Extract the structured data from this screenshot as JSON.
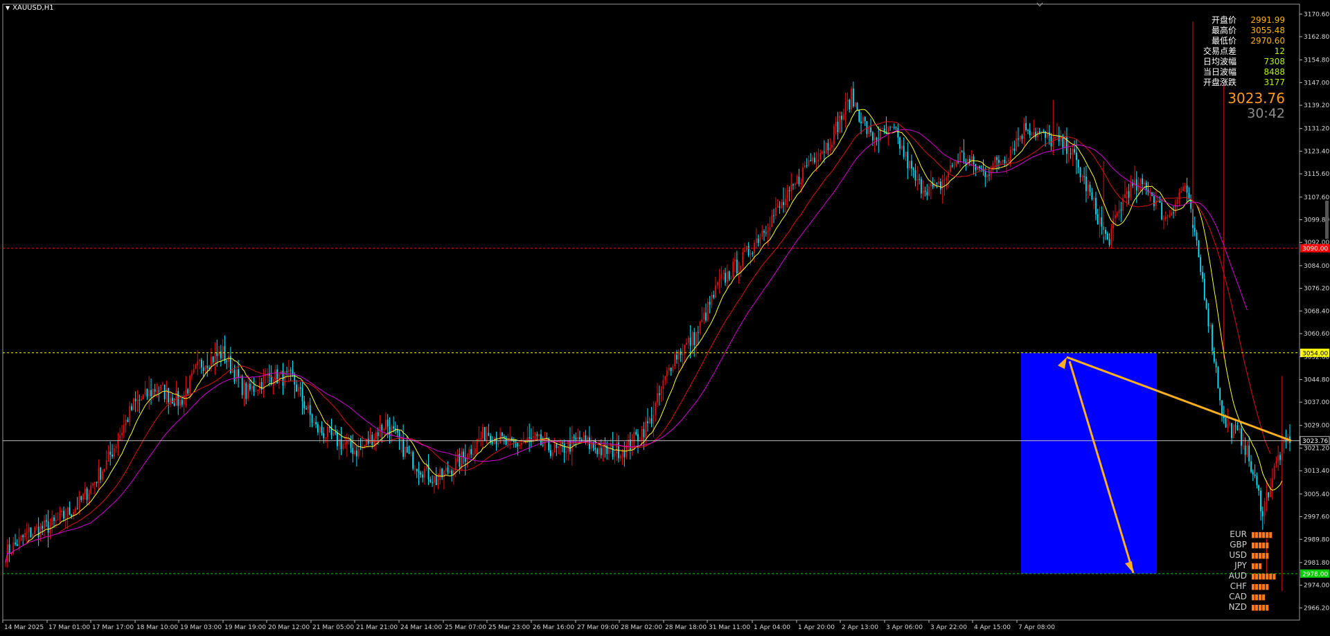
{
  "window": {
    "title": "XAUUSD,H1"
  },
  "info_panel": [
    {
      "label": "开盘价",
      "value": "2991.99"
    },
    {
      "label": "最高价",
      "value": "3055.48"
    },
    {
      "label": "最低价",
      "value": "2970.60"
    },
    {
      "label": "交易点差",
      "value": "12"
    },
    {
      "label": "日均波幅",
      "value": "7308"
    },
    {
      "label": "当日波幅",
      "value": "8488"
    },
    {
      "label": "开盘涨跌",
      "value": "3177"
    }
  ],
  "current_price": "3023.76",
  "timer": "30:42",
  "currency_strength": [
    {
      "name": "EUR",
      "bars": 6
    },
    {
      "name": "GBP",
      "bars": 5
    },
    {
      "name": "USD",
      "bars": 5
    },
    {
      "name": "JPY",
      "bars": 3
    },
    {
      "name": "AUD",
      "bars": 7
    },
    {
      "name": "CHF",
      "bars": 5
    },
    {
      "name": "CAD",
      "bars": 4
    },
    {
      "name": "NZD",
      "bars": 5
    }
  ],
  "colors": {
    "background": "#000000",
    "bull_candle": "#e01010",
    "bear_candle": "#00e5ff",
    "ma_fast": "#ffff33",
    "ma_mid": "#dd1111",
    "ma_slow": "#d400d4",
    "zone": "#0000ff",
    "arrow": "#ffb020",
    "label_red": "#ff0000",
    "label_yellow": "#ffff00",
    "label_green": "#00cc00"
  },
  "chart_data": {
    "type": "candlestick",
    "symbol": "XAUUSD,H1",
    "ylim": [
      2962.0,
      3174.0
    ],
    "y_ticks": [
      "3170.60",
      "3162.80",
      "3154.80",
      "3147.00",
      "3139.20",
      "3131.20",
      "3123.40",
      "3115.60",
      "3107.60",
      "3099.80",
      "3092.00",
      "3084.00",
      "3076.20",
      "3068.40",
      "3060.60",
      "3052.60",
      "3044.80",
      "3037.00",
      "3029.00",
      "3021.20",
      "3013.40",
      "3005.40",
      "2997.60",
      "2989.80",
      "2981.80",
      "2974.00",
      "2966.20"
    ],
    "x_labels": [
      "14 Mar 2025",
      "17 Mar 01:00",
      "17 Mar 17:00",
      "18 Mar 10:00",
      "19 Mar 03:00",
      "19 Mar 19:00",
      "20 Mar 12:00",
      "21 Mar 05:00",
      "21 Mar 21:00",
      "24 Mar 14:00",
      "25 Mar 07:00",
      "25 Mar 23:00",
      "26 Mar 16:00",
      "27 Mar 09:00",
      "28 Mar 02:00",
      "28 Mar 18:00",
      "31 Mar 11:00",
      "1 Apr 04:00",
      "1 Apr 20:00",
      "2 Apr 13:00",
      "3 Apr 06:00",
      "3 Apr 22:00",
      "4 Apr 15:00",
      "7 Apr 08:00"
    ],
    "horizontal_lines": [
      {
        "price": 3090.0,
        "label": "3090.00",
        "color": "#ff0000",
        "style": "dashed"
      },
      {
        "price": 3054.0,
        "label": "3054.00",
        "color": "#ffff00",
        "style": "dashed"
      },
      {
        "price": 3023.76,
        "label": "3023.76",
        "color": "#c0c0c0",
        "style": "solid"
      },
      {
        "price": 2978.0,
        "label": "2978.00",
        "color": "#00cc00",
        "style": "dashed"
      }
    ],
    "zone": {
      "price_high": 3054.0,
      "price_low": 2978.0
    },
    "price_path_anchors": [
      [
        0,
        2985
      ],
      [
        12,
        2992
      ],
      [
        25,
        2995
      ],
      [
        38,
        3002
      ],
      [
        52,
        3016
      ],
      [
        66,
        3036
      ],
      [
        78,
        3042
      ],
      [
        90,
        3037
      ],
      [
        100,
        3050
      ],
      [
        112,
        3054
      ],
      [
        124,
        3040
      ],
      [
        136,
        3046
      ],
      [
        148,
        3045
      ],
      [
        160,
        3028
      ],
      [
        170,
        3024
      ],
      [
        182,
        3020
      ],
      [
        196,
        3030
      ],
      [
        208,
        3018
      ],
      [
        222,
        3010
      ],
      [
        236,
        3018
      ],
      [
        248,
        3027
      ],
      [
        260,
        3022
      ],
      [
        272,
        3024
      ],
      [
        284,
        3020
      ],
      [
        296,
        3024
      ],
      [
        308,
        3020
      ],
      [
        320,
        3021
      ],
      [
        332,
        3030
      ],
      [
        344,
        3052
      ],
      [
        356,
        3060
      ],
      [
        368,
        3078
      ],
      [
        380,
        3086
      ],
      [
        392,
        3098
      ],
      [
        404,
        3108
      ],
      [
        414,
        3120
      ],
      [
        424,
        3126
      ],
      [
        436,
        3142
      ],
      [
        446,
        3128
      ],
      [
        458,
        3130
      ],
      [
        470,
        3112
      ],
      [
        480,
        3110
      ],
      [
        492,
        3122
      ],
      [
        504,
        3116
      ],
      [
        516,
        3122
      ],
      [
        526,
        3132
      ],
      [
        536,
        3128
      ],
      [
        548,
        3125
      ],
      [
        558,
        3110
      ],
      [
        568,
        3092
      ],
      [
        578,
        3110
      ],
      [
        588,
        3112
      ],
      [
        598,
        3100
      ],
      [
        608,
        3112
      ],
      [
        618,
        3075
      ],
      [
        628,
        3030
      ],
      [
        638,
        3024
      ],
      [
        648,
        3000
      ],
      [
        656,
        3018
      ],
      [
        662,
        3025
      ]
    ]
  }
}
